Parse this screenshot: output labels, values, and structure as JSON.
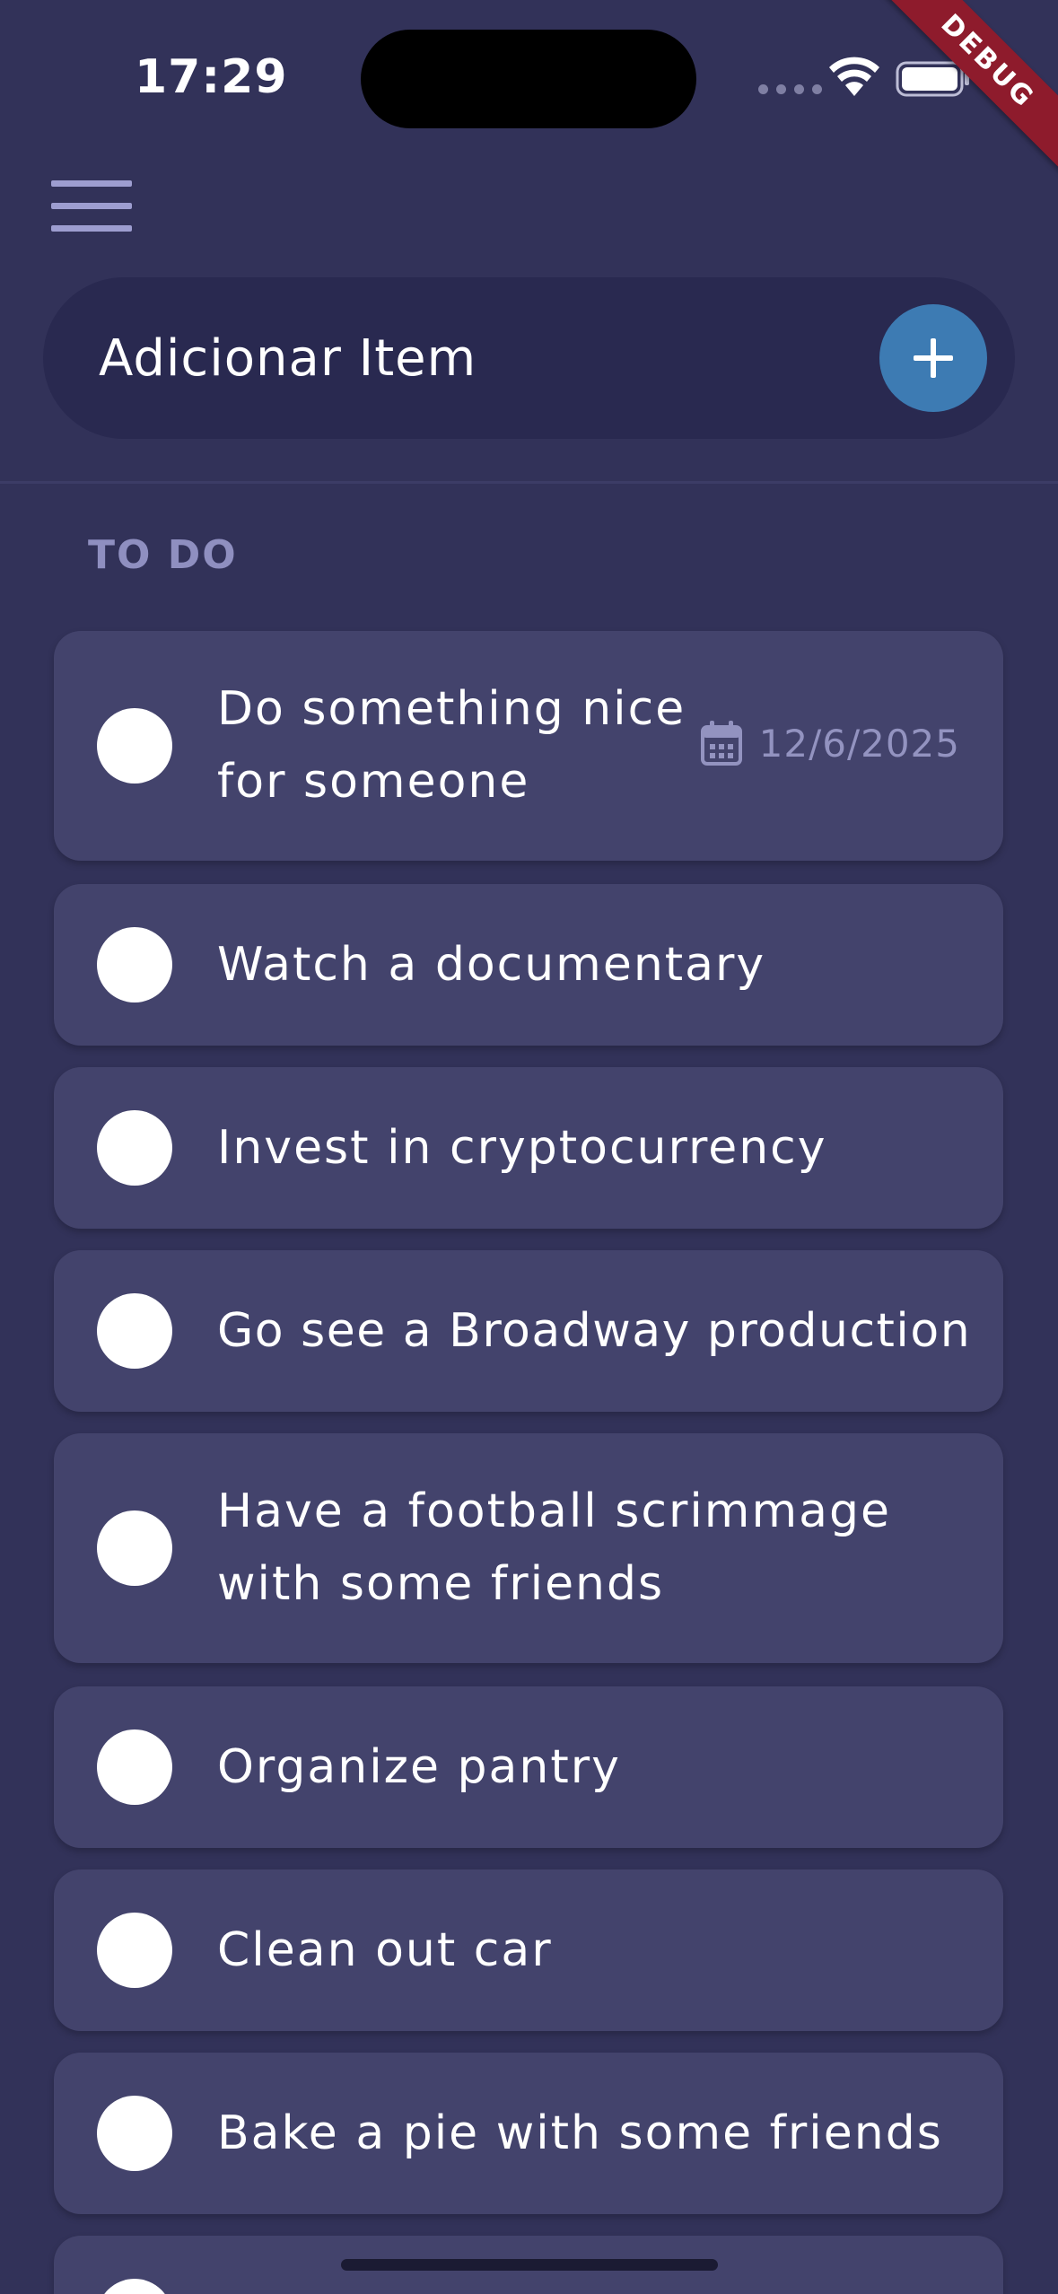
{
  "status_bar": {
    "time": "17:29",
    "debug_banner": "DEBUG"
  },
  "header": {
    "menu_icon": "menu-icon"
  },
  "add_item": {
    "placeholder": "Adicionar Item",
    "button_icon": "plus-icon",
    "button_color": "#3d7bb3"
  },
  "section": {
    "title": "TO DO"
  },
  "tasks": [
    {
      "lines": [
        "Do something nice",
        "for someone"
      ],
      "date": "12/6/2025",
      "date_icon": "calendar-icon"
    },
    {
      "lines": [
        "Watch a documentary"
      ]
    },
    {
      "lines": [
        "Invest in cryptocurrency"
      ]
    },
    {
      "lines": [
        "Go see a Broadway production"
      ]
    },
    {
      "lines": [
        "Have a football scrimmage",
        "with some friends"
      ]
    },
    {
      "lines": [
        "Organize pantry"
      ]
    },
    {
      "lines": [
        "Clean out car"
      ]
    },
    {
      "lines": [
        "Bake a pie with some friends"
      ]
    }
  ],
  "colors": {
    "background": "#323259",
    "card": "#43436c",
    "input_bar": "#292950",
    "section_title": "#8f8fc0",
    "debug_banner": "#8e1b2c"
  }
}
